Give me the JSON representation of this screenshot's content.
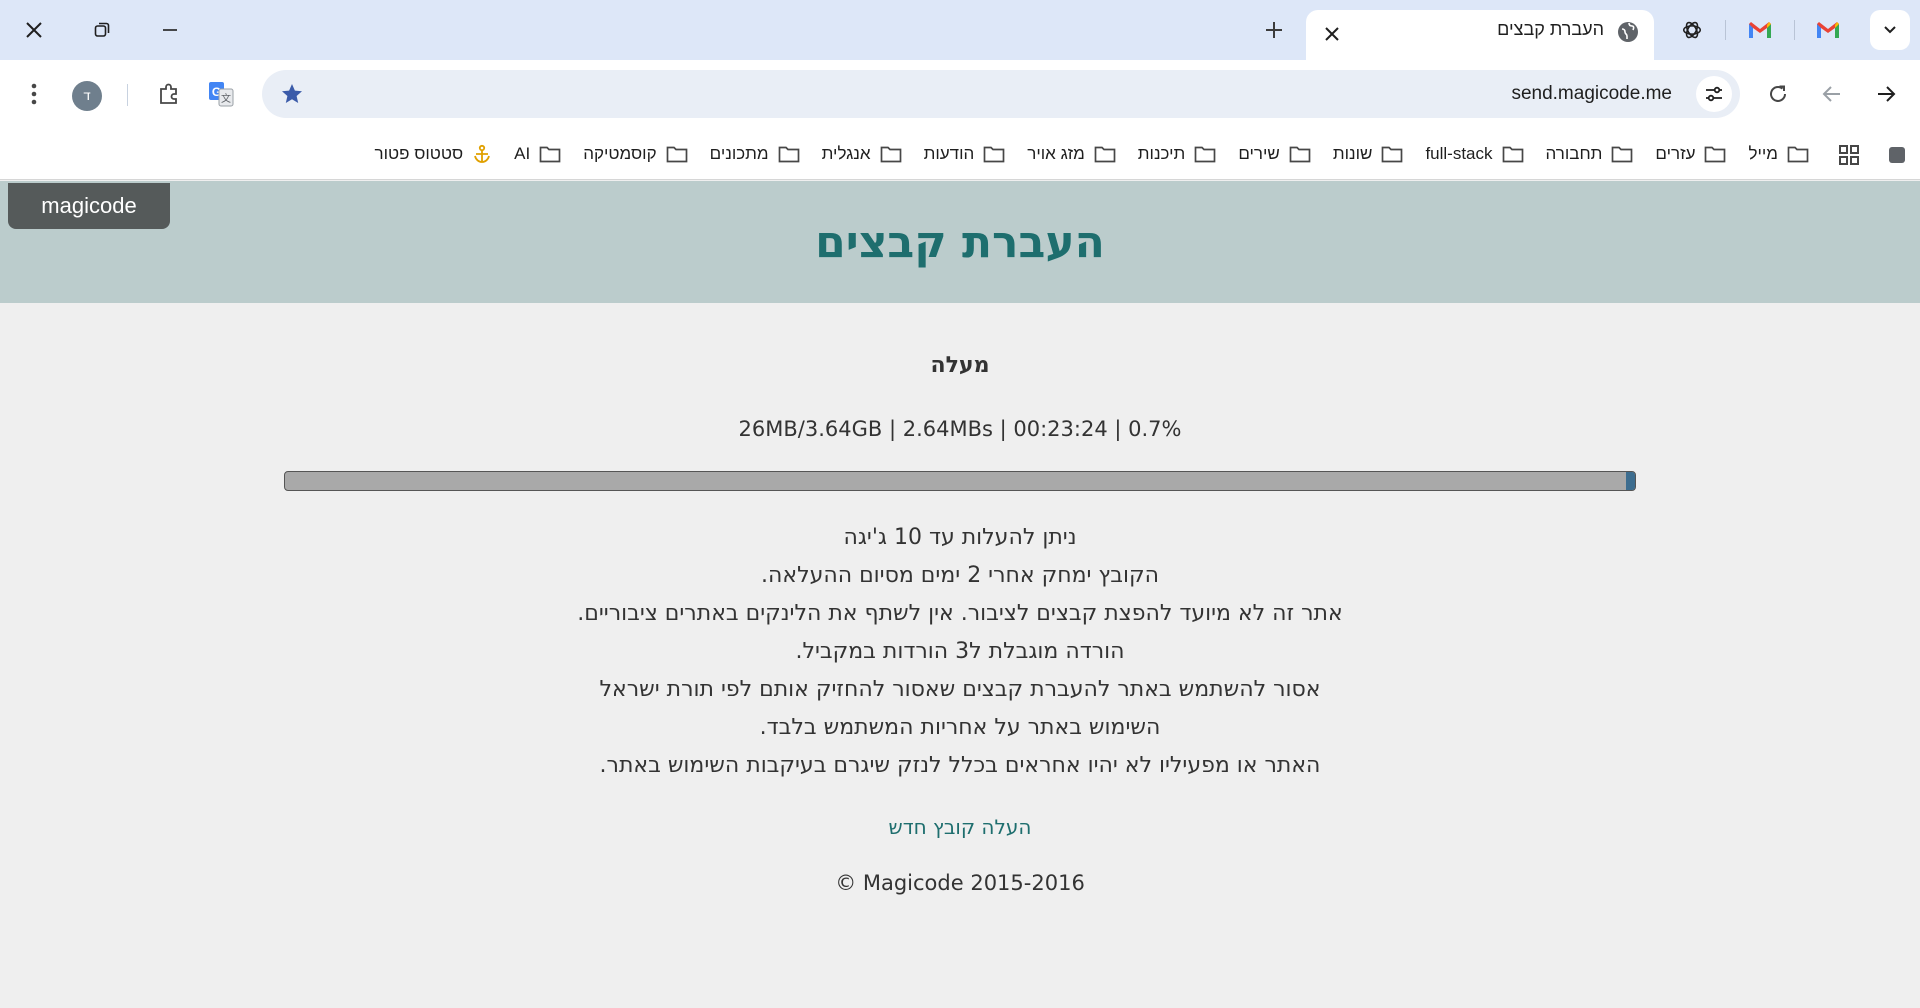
{
  "browser": {
    "tab": {
      "title": "העברת קבצים"
    },
    "url": "send.magicode.me",
    "profile_initial": "ד"
  },
  "bookmarks": [
    {
      "label": "מייל",
      "icon": "folder-icon"
    },
    {
      "label": "עזרים",
      "icon": "folder-icon"
    },
    {
      "label": "תחבורה",
      "icon": "folder-icon"
    },
    {
      "label": "full-stack",
      "icon": "folder-icon"
    },
    {
      "label": "שונות",
      "icon": "folder-icon"
    },
    {
      "label": "שירים",
      "icon": "folder-icon"
    },
    {
      "label": "תיכנות",
      "icon": "folder-icon"
    },
    {
      "label": "מזג אויר",
      "icon": "folder-icon"
    },
    {
      "label": "הודעות",
      "icon": "folder-icon"
    },
    {
      "label": "אנגלית",
      "icon": "folder-icon"
    },
    {
      "label": "מתכונים",
      "icon": "folder-icon"
    },
    {
      "label": "קוסמטיקה",
      "icon": "folder-icon"
    },
    {
      "label": "AI",
      "icon": "folder-icon"
    },
    {
      "label": "סטטוס פטור",
      "icon": "anchor-icon"
    }
  ],
  "site": {
    "brand": "magicode",
    "title": "העברת קבצים"
  },
  "upload": {
    "status": "מעלה",
    "stats": "26MB/3.64GB | 2.64MBs | 00:23:24 | 0.7%",
    "progress_percent": 0.7
  },
  "notes": [
    "ניתן להעלות עד 10 ג'יגה",
    "הקובץ ימחק אחרי 2 ימים מסיום ההעלאה.",
    "אתר זה לא מיועד להפצת קבצים לציבור. אין לשתף את הלינקים באתרים ציבוריים.",
    "הורדה מוגבלת ל3 הורדות במקביל.",
    "אסור להשתמש באתר להעברת קבצים שאסור להחזיק אותם לפי תורת ישראל",
    "השימוש באתר על אחריות המשתמש בלבד.",
    "האתר או מפעיליו לא יהיו אחראים בכלל לנזק שיגרם בעיקבות השימוש באתר."
  ],
  "new_upload_link": "העלה קובץ חדש",
  "copyright": "© Magicode 2015-2016",
  "colors": {
    "header_bg": "#bbcccc",
    "title": "#1e6e6e",
    "progress_fill": "#3d6d8f",
    "progress_track": "#a9a9a9"
  }
}
